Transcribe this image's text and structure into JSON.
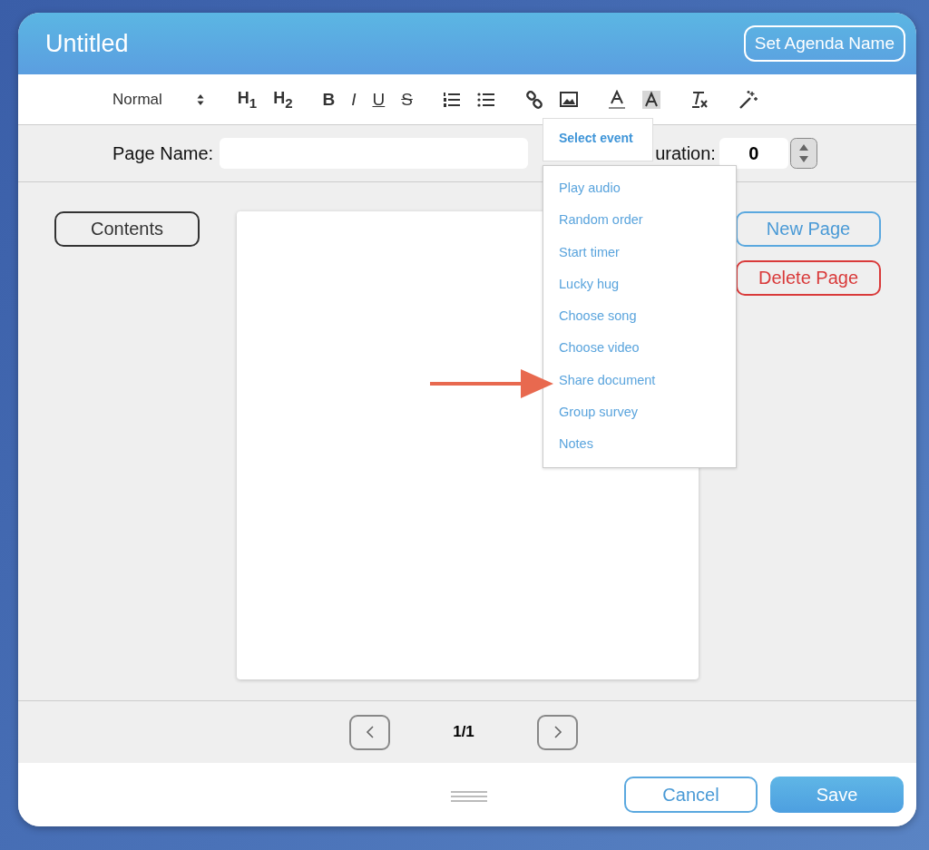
{
  "window": {
    "title": "Untitled",
    "header_button": "Set Agenda Name"
  },
  "toolbar": {
    "format": "Normal",
    "groups": [
      [
        {
          "kind": "text",
          "label": "H$_{1}$"
        },
        {
          "kind": "text",
          "label": "H$_{2}$"
        }
      ],
      [
        {
          "kind": "bold",
          "label": "B"
        },
        {
          "kind": "italic",
          "label": "I"
        },
        {
          "kind": "underline",
          "label": "U"
        },
        {
          "kind": "strike",
          "label": "S"
        }
      ],
      [
        {
          "kind": "ordered-list"
        },
        {
          "kind": "bullet-list"
        }
      ],
      [
        {
          "kind": "link"
        },
        {
          "kind": "image"
        }
      ],
      [
        {
          "kind": "font-color"
        },
        {
          "kind": "highlight"
        }
      ],
      [
        {
          "kind": "clear-format"
        }
      ],
      [
        {
          "kind": "magic"
        }
      ]
    ]
  },
  "page_name": {
    "label": "Page Name:"
  },
  "duration": {
    "label": "uration:",
    "value": "0"
  },
  "event_popup": {
    "title": "Select event",
    "items": [
      "Play audio",
      "Random order",
      "Start timer",
      "Lucky hug",
      "Choose song",
      "Choose video",
      "Share document",
      "Group survey",
      "Notes"
    ]
  },
  "contents_button": "Contents",
  "side_buttons": [
    {
      "label": "New Page",
      "kind": "primary"
    },
    {
      "label": "Delete Page",
      "kind": "danger"
    }
  ],
  "pagination": "1/1",
  "footer_buttons": [
    {
      "label": "Cancel",
      "kind": "outline"
    },
    {
      "label": "Save",
      "kind": "filled"
    }
  ]
}
